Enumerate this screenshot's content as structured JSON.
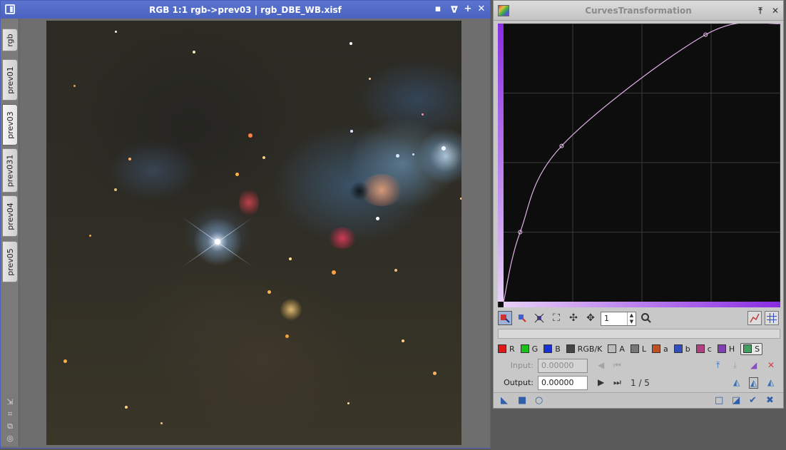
{
  "image_window": {
    "title": "RGB 1:1 rgb->prev03 | rgb_DBE_WB.xisf",
    "buttons": {
      "shade": "▪",
      "minimize": "ᐅ",
      "maximize": "+",
      "close": "✕"
    },
    "views": [
      "rgb",
      "prev01",
      "prev03",
      "prev031",
      "prev04",
      "prev05"
    ],
    "active_view": "prev03"
  },
  "curves_window": {
    "title": "CurvesTransformation",
    "zoom_value": "1",
    "channels": [
      {
        "label": "R",
        "color": "#e01818"
      },
      {
        "label": "G",
        "color": "#18c018"
      },
      {
        "label": "B",
        "color": "#1830d8"
      },
      {
        "label": "RGB/K",
        "color": "#444444"
      },
      {
        "label": "A",
        "color": "#bbbbbb"
      },
      {
        "label": "L",
        "color": "#777777"
      },
      {
        "label": "a",
        "color": "#c05020"
      },
      {
        "label": "b",
        "color": "#3050c0"
      },
      {
        "label": "c",
        "color": "#b04080"
      },
      {
        "label": "H",
        "color": "#8040b0"
      },
      {
        "label": "S",
        "color": "#40a060"
      }
    ],
    "active_channel": "S",
    "input_label": "Input:",
    "input_value": "0.00000",
    "output_label": "Output:",
    "output_value": "0.00000",
    "point_counter": "1 / 5",
    "curve_points": [
      [
        0,
        0
      ],
      [
        0.06,
        0.25
      ],
      [
        0.21,
        0.56
      ],
      [
        0.73,
        0.96
      ],
      [
        1,
        1
      ]
    ],
    "curve_color": "#e0b0e8",
    "gradient_color": "#8a2be2"
  }
}
